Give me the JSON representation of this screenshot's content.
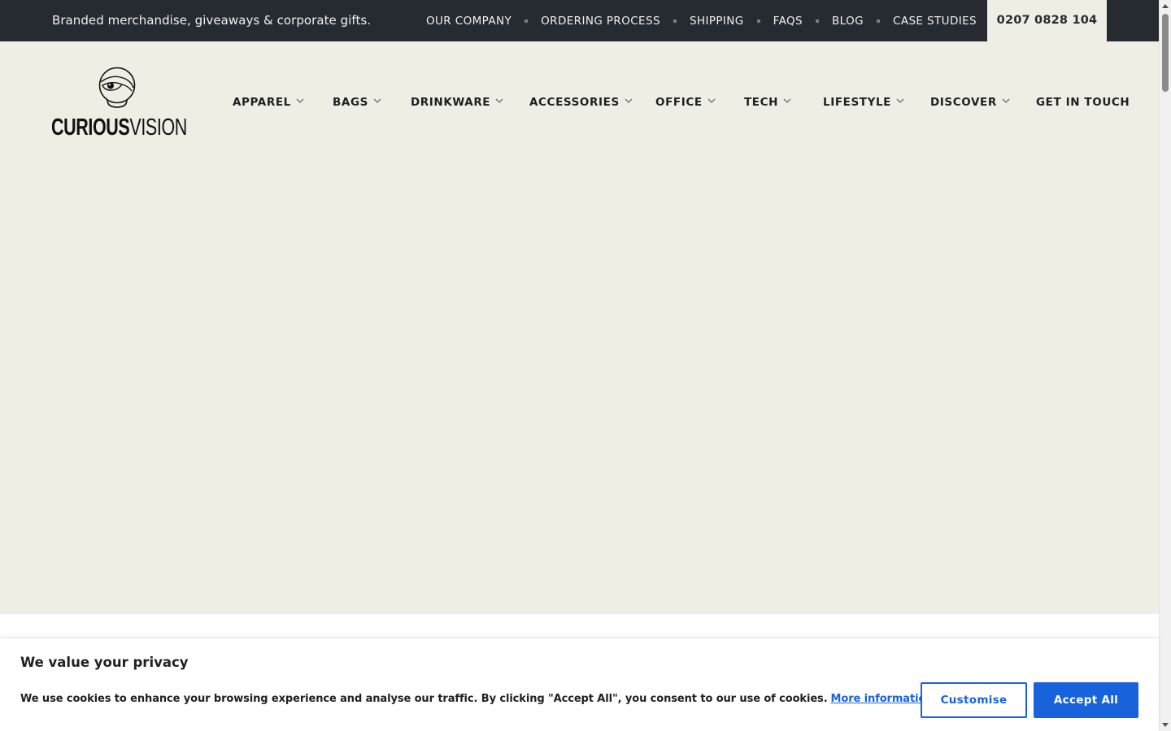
{
  "topbar": {
    "tagline": "Branded merchandise, giveaways & corporate gifts.",
    "links": [
      "OUR COMPANY",
      "ORDERING PROCESS",
      "SHIPPING",
      "FAQS",
      "BLOG",
      "CASE STUDIES"
    ],
    "phone": "0207 0828 104"
  },
  "logo": {
    "word1": "CURIOUS",
    "word2": "VISION",
    "icon": "crystal-ball-eye-icon"
  },
  "nav": {
    "items": [
      {
        "label": "APPAREL",
        "has_dropdown": true
      },
      {
        "label": "BAGS",
        "has_dropdown": true
      },
      {
        "label": "DRINKWARE",
        "has_dropdown": true
      },
      {
        "label": "ACCESSORIES",
        "has_dropdown": true
      },
      {
        "label": "OFFICE",
        "has_dropdown": true
      },
      {
        "label": "TECH",
        "has_dropdown": true
      },
      {
        "label": "LIFESTYLE",
        "has_dropdown": true
      },
      {
        "label": "DISCOVER",
        "has_dropdown": true
      },
      {
        "label": "GET IN TOUCH",
        "has_dropdown": false
      }
    ],
    "dropdown_icon": "chevron-down-icon"
  },
  "cookie": {
    "title": "We value your privacy",
    "text": "We use cookies to enhance your browsing experience and analyse our traffic. By clicking \"Accept All\", you consent to our use of cookies.",
    "link": "More information",
    "customise": "Customise",
    "accept": "Accept All"
  },
  "colors": {
    "topbar_bg": "#262a31",
    "page_bg": "#efeee5",
    "accent": "#1863dc",
    "text_dark": "#1c1f24"
  }
}
